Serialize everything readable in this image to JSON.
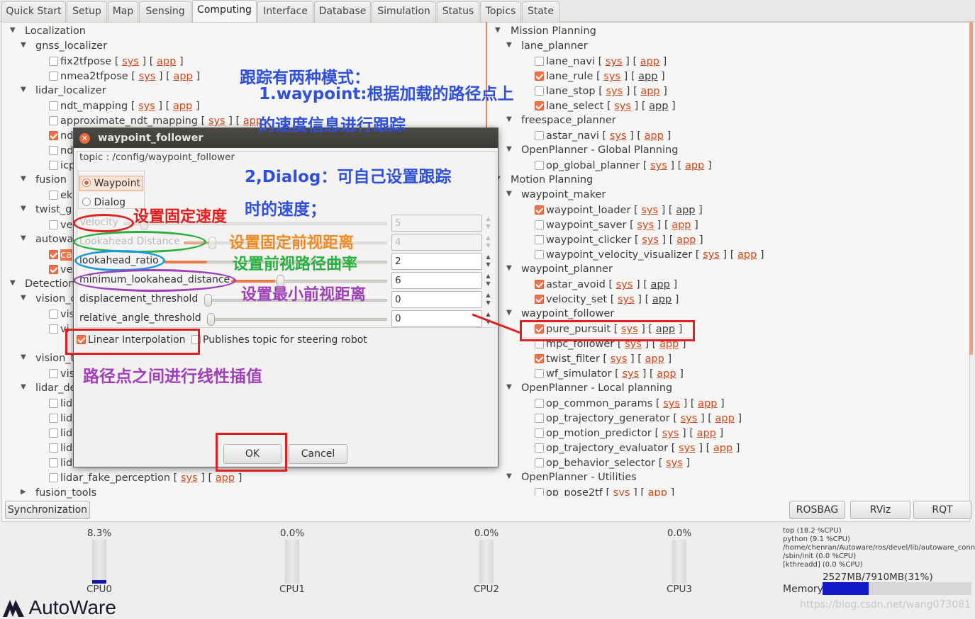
{
  "tabs": [
    "Quick Start",
    "Setup",
    "Map",
    "Sensing",
    "Computing",
    "Interface",
    "Database",
    "Simulation",
    "Status",
    "Topics",
    "State"
  ],
  "active_tab": "Computing",
  "link_sys": "sys",
  "link_app": "app",
  "left_tree": {
    "localization": "Localization",
    "gnss_localizer": "gnss_localizer",
    "fix2tfpose": "fix2tfpose",
    "nmea2tfpose": "nmea2tfpose",
    "lidar_localizer": "lidar_localizer",
    "ndt_mapping": "ndt_mapping",
    "approximate_ndt_mapping": "approximate_ndt_mapping",
    "nd1": "nd",
    "nd2": "nd",
    "icp": "icp",
    "fusion": "fusion",
    "ek": "ek",
    "twist": "twist_g",
    "ve": "ve",
    "autowa": "autowa",
    "ca": "ca",
    "ve2": "ve",
    "detection": "Detection",
    "vision_d": "vision_c",
    "vis1": "vis",
    "vis2": "vi",
    "vision_t": "vision_t",
    "vis3": "vis",
    "lidar_de": "lidar_de",
    "lid1": "lid",
    "lid2": "lid",
    "lid3": "lid",
    "lid4": "lid",
    "lid5": "lid",
    "lidar_fake_perception": "lidar_fake_perception",
    "fusion_tools": "fusion_tools"
  },
  "right_tree": {
    "mission_planning": "Mission Planning",
    "lane_planner": "lane_planner",
    "lane_navi": "lane_navi",
    "lane_rule": "lane_rule",
    "lane_stop": "lane_stop",
    "lane_select": "lane_select",
    "freespace_planner": "freespace_planner",
    "astar_navi": "astar_navi",
    "openplanner_global": "OpenPlanner - Global Planning",
    "op_global_planner": "op_global_planner",
    "motion_planning": "Motion Planning",
    "waypoint_maker": "waypoint_maker",
    "waypoint_loader": "waypoint_loader",
    "waypoint_saver": "waypoint_saver",
    "waypoint_clicker": "waypoint_clicker",
    "waypoint_velocity_visualizer": "waypoint_velocity_visualizer",
    "waypoint_planner": "waypoint_planner",
    "astar_avoid": "astar_avoid",
    "velocity_set": "velocity_set",
    "waypoint_follower": "waypoint_follower",
    "pure_pursuit": "pure_pursuit",
    "mpc_follower": "mpc_follower",
    "twist_filter": "twist_filter",
    "wf_simulator": "wf_simulator",
    "openplanner_local": "OpenPlanner - Local planning",
    "op_common_params": "op_common_params",
    "op_trajectory_generator": "op_trajectory_generator",
    "op_motion_predictor": "op_motion_predictor",
    "op_trajectory_evaluator": "op_trajectory_evaluator",
    "op_behavior_selector": "op_behavior_selector",
    "openplanner_utilities": "OpenPlanner - Utilities",
    "op_pose2tf": "op_pose2tf"
  },
  "dialog": {
    "title": "waypoint_follower",
    "topic": "topic : /config/waypoint_follower",
    "mode_waypoint": "Waypoint",
    "mode_dialog": "Dialog",
    "velocity_label": "Velocity",
    "velocity_value": "5",
    "lookahead_distance_label": "Lookahead Distance",
    "lookahead_distance_value": "4",
    "lookahead_ratio_label": "lookahead_ratio",
    "lookahead_ratio_value": "2",
    "min_lookahead_label": "minimum_lookahead_distance",
    "min_lookahead_value": "6",
    "displacement_label": "displacement_threshold",
    "displacement_value": "0",
    "relative_angle_label": "relative_angle_threshold",
    "relative_angle_value": "0",
    "linear_interp": "Linear Interpolation",
    "publishes_topic": "Publishes topic for steering robot",
    "ok": "OK",
    "cancel": "Cancel"
  },
  "bottom": {
    "synchronization": "Synchronization",
    "rosbag": "ROSBAG",
    "rviz": "RViz",
    "rqt": "RQT",
    "cpus": [
      {
        "label": "CPU0",
        "pct": "8.3%",
        "fill": 0.083
      },
      {
        "label": "CPU1",
        "pct": "0.0%",
        "fill": 0
      },
      {
        "label": "CPU2",
        "pct": "0.0%",
        "fill": 0
      },
      {
        "label": "CPU3",
        "pct": "0.0%",
        "fill": 0
      }
    ],
    "top_lines": [
      "top (18.2 %CPU)",
      "python (9.1 %CPU)",
      "/home/chenran/Autoware/ros/devel/lib/autoware_conn",
      "/sbin/init (0.0 %CPU)",
      "[kthreadd] (0.0 %CPU)"
    ],
    "memory_label": "Memory",
    "memory_value": "2527MB/7910MB(31%)",
    "memory_fill": 0.31,
    "logo": "AutoWare",
    "watermark": "https://blog.csdn.net/wang073081"
  },
  "annotations": {
    "a1": "跟踪有两种模式：",
    "a2": "1.waypoint:根据加载的路径点上",
    "a3": "的速度信息进行跟踪",
    "a4": "2,Dialog：可自己设置跟踪",
    "a5": "时的速度；",
    "a6": "设置固定速度",
    "a7": "设置固定前视距离",
    "a8": "设置前视路径曲率",
    "a9": "设置最小前视距离",
    "a10": "路径点之间进行线性插值"
  },
  "colors": {
    "accent": "#f07746",
    "link": "#d0481c",
    "annotation_red": "#e02020",
    "annotation_blue": "#3050d8",
    "annotation_orange": "#f08a24",
    "annotation_green": "#28b040",
    "annotation_purple": "#a040b8"
  }
}
